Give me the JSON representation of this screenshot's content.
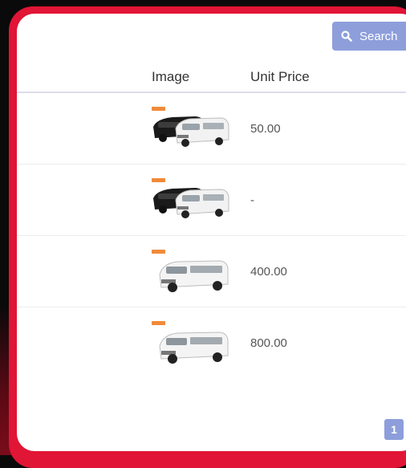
{
  "toolbar": {
    "search_label": "Search",
    "search_icon": "search-icon"
  },
  "table": {
    "columns": [
      "Image",
      "Unit Price"
    ],
    "rows": [
      {
        "image": "van-pair-photo",
        "unit_price": "50.00"
      },
      {
        "image": "van-pair-photo",
        "unit_price": "-"
      },
      {
        "image": "white-van-photo",
        "unit_price": "400.00"
      },
      {
        "image": "white-van-photo",
        "unit_price": "800.00"
      }
    ]
  },
  "pagination": {
    "current_page": "1"
  },
  "colors": {
    "frame": "#e11535",
    "button": "#8d9edb",
    "tag": "#f08a3a"
  }
}
